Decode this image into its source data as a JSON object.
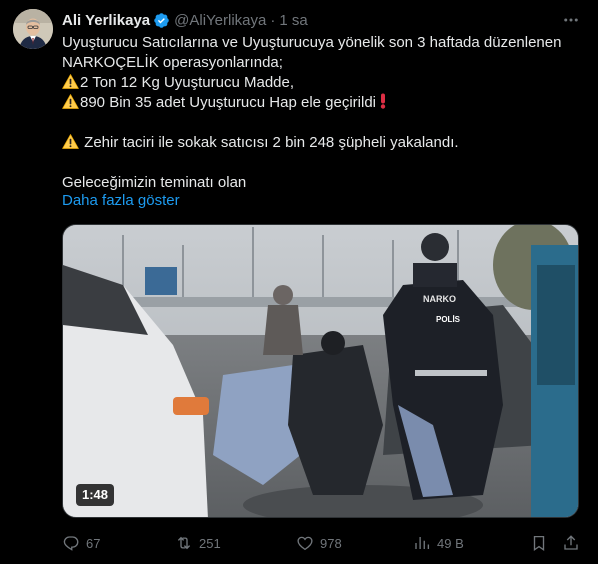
{
  "author": {
    "name": "Ali Yerlikaya",
    "handle": "@AliYerlikaya",
    "separator": "·",
    "time": "1 sa"
  },
  "tweet": {
    "line1": "Uyuşturucu Satıcılarına ve Uyuşturucuya yönelik son 3 haftada düzenlenen",
    "line2": "NARKOÇELİK operasyonlarında;",
    "line3": "2 Ton 12 Kg Uyuşturucu Madde,",
    "line4": "890 Bin 35 adet Uyuşturucu Hap ele geçirildi",
    "line5": " Zehir taciri ile sokak satıcısı 2 bin 248 şüpheli yakalandı.",
    "line6": "Geleceğimizin teminatı olan",
    "show_more": "Daha fazla göster"
  },
  "media": {
    "duration": "1:48",
    "vest_text": "POLİS",
    "sign_text": "NARKO"
  },
  "actions": {
    "replies": "67",
    "reposts": "251",
    "likes": "978",
    "views": "49 B"
  },
  "icons": {
    "verified": "verified-badge-icon",
    "more": "more-options-icon",
    "warning": "warning-icon",
    "reply": "reply-icon",
    "repost": "repost-icon",
    "like": "like-icon",
    "views": "views-icon",
    "bookmark": "bookmark-icon",
    "share": "share-icon"
  },
  "colors": {
    "background": "#000000",
    "text": "#e7e9ea",
    "muted": "#71767b",
    "link": "#1d9bf0",
    "verified": "#1d9bf0",
    "warning": "#ffcc4d"
  }
}
